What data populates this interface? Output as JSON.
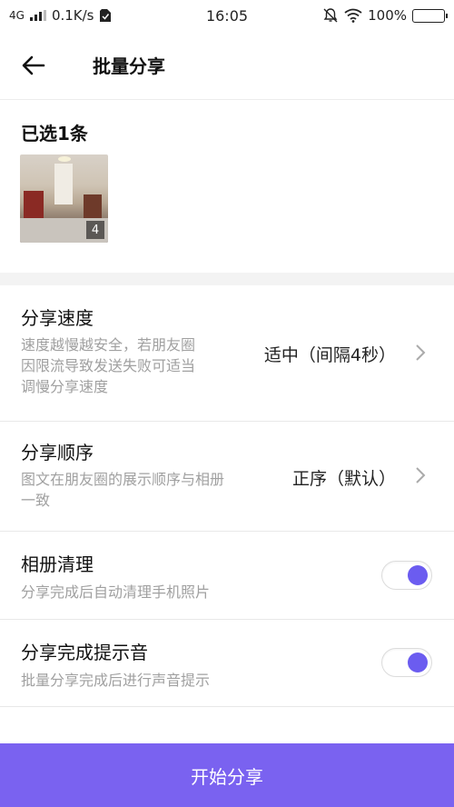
{
  "status_bar": {
    "network": "4G",
    "speed": "0.1K/s",
    "time": "16:05",
    "battery": "100%"
  },
  "header": {
    "back_icon": "arrow-left-icon",
    "title": "批量分享"
  },
  "selected": {
    "label": "已选1条",
    "thumbnail_count": "4"
  },
  "settings": {
    "speed": {
      "title": "分享速度",
      "desc_lines": [
        "速度越慢越安全，若朋友圈",
        "因限流导致发送失败可适当",
        "调慢分享速度"
      ],
      "value": "适中（间隔4秒）"
    },
    "order": {
      "title": "分享顺序",
      "desc_lines": [
        "图文在朋友圈的展示顺序与相册",
        "一致"
      ],
      "value": "正序（默认）"
    },
    "cleanup": {
      "title": "相册清理",
      "desc": "分享完成后自动清理手机照片",
      "enabled": true
    },
    "sound": {
      "title": "分享完成提示音",
      "desc": "批量分享完成后进行声音提示",
      "enabled": true
    }
  },
  "footer": {
    "start_label": "开始分享"
  },
  "colors": {
    "accent": "#7a62f0",
    "toggle_knob": "#6b5cf0",
    "desc_text": "#a0a0a0"
  }
}
